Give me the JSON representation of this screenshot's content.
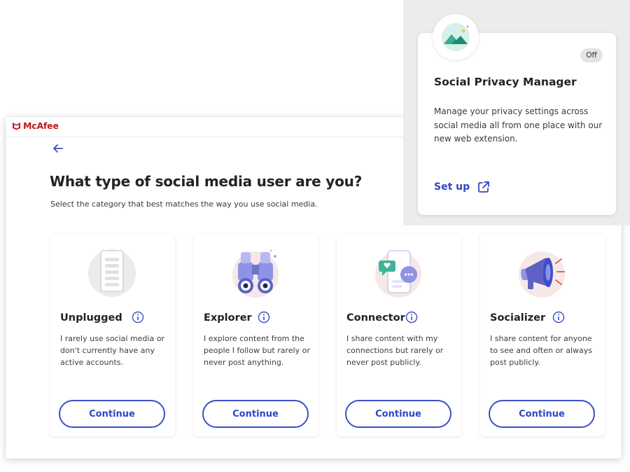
{
  "app": {
    "brand": "McAfee"
  },
  "page": {
    "title": "What type of social media user are you?",
    "subtitle": "Select the category that best matches the way you use social media."
  },
  "cards": [
    {
      "name": "Unplugged",
      "description": "I rarely use social media or don't currently have any active accounts.",
      "button": "Continue",
      "icon": "phone-icon"
    },
    {
      "name": "Explorer",
      "description": "I explore content from the people I follow but rarely or never post anything.",
      "button": "Continue",
      "icon": "binoculars-icon"
    },
    {
      "name": "Connector",
      "description": "I share content with my connections but rarely or never post publicly.",
      "button": "Continue",
      "icon": "chat-phone-icon"
    },
    {
      "name": "Socializer",
      "description": "I share content for anyone to see and often or always post publicly.",
      "button": "Continue",
      "icon": "megaphone-icon"
    }
  ],
  "popup": {
    "badge": "Off",
    "title": "Social Privacy Manager",
    "description": "Manage your privacy settings across social media all from one place with our new web extension.",
    "action": "Set up"
  },
  "colors": {
    "brand_red": "#c01818",
    "accent_blue": "#2f46c5",
    "illustration_purple": "#7b7fd8"
  }
}
